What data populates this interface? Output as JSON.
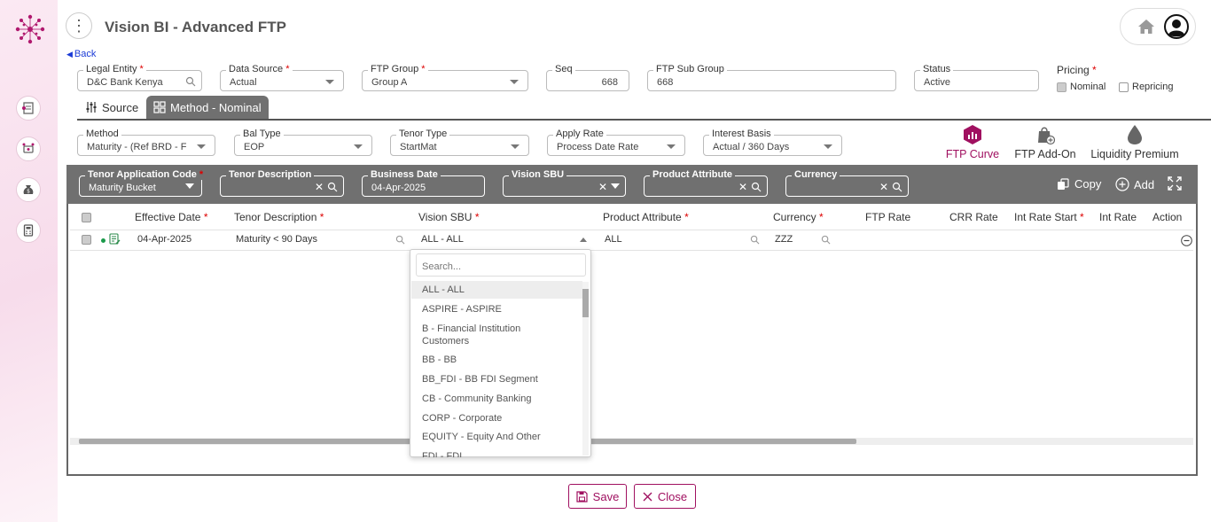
{
  "app_title": "Vision BI - Advanced FTP",
  "back_label": "Back",
  "form": {
    "legal_entity": {
      "label": "Legal Entity",
      "value": "D&C Bank Kenya"
    },
    "data_source": {
      "label": "Data Source",
      "value": "Actual"
    },
    "ftp_group": {
      "label": "FTP Group",
      "value": "Group A"
    },
    "seq": {
      "label": "Seq",
      "value": "668"
    },
    "ftp_sub_group": {
      "label": "FTP Sub Group",
      "value": "668"
    },
    "status": {
      "label": "Status",
      "value": "Active"
    },
    "pricing": {
      "label": "Pricing",
      "options": [
        "Nominal",
        "Repricing"
      ],
      "selected": "Nominal"
    }
  },
  "tabs": [
    {
      "label": "Source"
    },
    {
      "label": "Method - Nominal",
      "active": true
    }
  ],
  "method_form": {
    "method": {
      "label": "Method",
      "value": "Maturity - (Ref BRD - F"
    },
    "bal_type": {
      "label": "Bal Type",
      "value": "EOP"
    },
    "tenor_type": {
      "label": "Tenor Type",
      "value": "StartMat"
    },
    "apply_rate": {
      "label": "Apply Rate",
      "value": "Process Date Rate"
    },
    "interest_basis": {
      "label": "Interest Basis",
      "value": "Actual / 360 Days"
    }
  },
  "action_icons": [
    {
      "label": "FTP Curve",
      "active": true
    },
    {
      "label": "FTP Add-On"
    },
    {
      "label": "Liquidity Premium"
    }
  ],
  "grid_filters": {
    "tenor_app_code": {
      "label": "Tenor Application Code",
      "value": "Maturity Bucket"
    },
    "tenor_desc": {
      "label": "Tenor Description",
      "value": ""
    },
    "business_date": {
      "label": "Business Date",
      "value": "04-Apr-2025"
    },
    "vision_sbu": {
      "label": "Vision SBU",
      "value": ""
    },
    "product_attribute": {
      "label": "Product Attribute",
      "value": ""
    },
    "currency": {
      "label": "Currency",
      "value": ""
    }
  },
  "grid_actions": {
    "copy": "Copy",
    "add": "Add"
  },
  "columns": [
    "Effective Date",
    "Tenor Description",
    "Vision SBU",
    "Product Attribute",
    "Currency",
    "FTP Rate",
    "CRR Rate",
    "Int Rate Start",
    "Int Rate E",
    "Action"
  ],
  "rows": [
    {
      "effective_date": "04-Apr-2025",
      "tenor_description": "Maturity < 90 Days",
      "vision_sbu": "ALL - ALL",
      "product_attribute": "ALL",
      "currency": "ZZZ"
    }
  ],
  "dropdown": {
    "search_placeholder": "Search...",
    "items": [
      "ALL - ALL",
      "ASPIRE - ASPIRE",
      "B - Financial Institution Customers",
      "BB - BB",
      "BB_FDI - BB FDI Segment",
      "CB - Community Banking",
      "CORP - Corporate",
      "EQUITY - Equity And Other",
      "FDI - FDI"
    ]
  },
  "footer": {
    "save": "Save",
    "close": "Close"
  },
  "colors": {
    "accent": "#a01060",
    "grid_header": "#707070"
  }
}
